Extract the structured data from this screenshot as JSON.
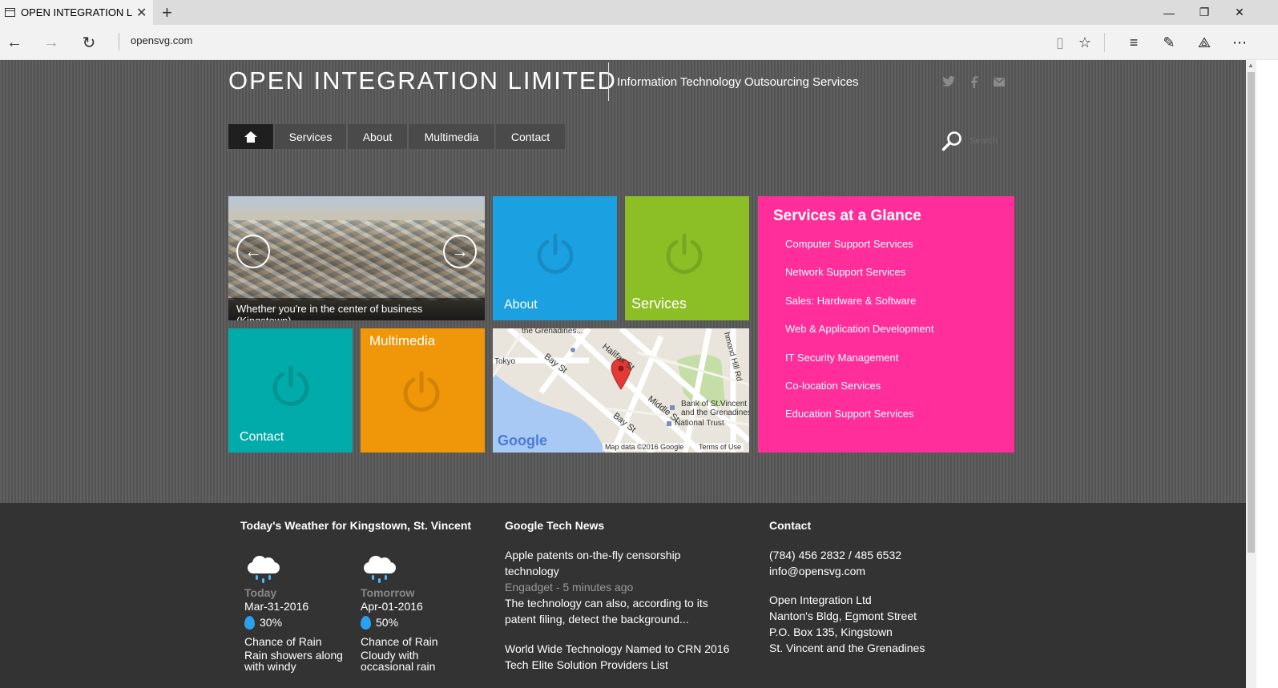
{
  "browser": {
    "tab_title": "OPEN INTEGRATION LIN",
    "address": "opensvg.com"
  },
  "site": {
    "title": "OPEN INTEGRATION LIMITED",
    "tagline": "Information Technology Outsourcing Services",
    "social_icons": [
      "twitter-icon",
      "facebook-icon",
      "mail-icon"
    ],
    "search_placeholder": "Search"
  },
  "menu": {
    "items": [
      {
        "label": "Services"
      },
      {
        "label": "About"
      },
      {
        "label": "Multimedia"
      },
      {
        "label": "Contact"
      }
    ]
  },
  "tiles": {
    "slide_caption": "Whether you're in the center of business (Kingstown)",
    "about": "About",
    "services": "Services",
    "contact": "Contact",
    "multimedia": "Multimedia",
    "colors": {
      "about": "#1ba1e2",
      "services": "#8cbf26",
      "contact": "#00aba9",
      "multimedia": "#f09609",
      "glance": "#ff2e9a"
    }
  },
  "map": {
    "labels": [
      "the Grenadines...",
      "Tokyo",
      "Bay St",
      "Halifax St",
      "Middle St",
      "Bay St",
      "hmond Hill Rd",
      "Bank of St.Vincent",
      "and the Grenadines",
      "National Trust"
    ],
    "attribution": "Map data ©2016 Google",
    "terms": "Terms of Use",
    "logo": "Google"
  },
  "glance": {
    "title": "Services at a Glance",
    "items": [
      "Computer Support Services",
      "Network Support Services",
      "Sales: Hardware & Software",
      "Web & Application Development",
      "IT Security Management",
      "Co-location Services",
      "Education Support Services"
    ]
  },
  "weather": {
    "heading": "Today's Weather for Kingstown, St. Vincent",
    "days": [
      {
        "day": "Today",
        "date": "Mar-31-2016",
        "chance": "30%",
        "label": "Chance of Rain",
        "desc": "Rain showers along with windy"
      },
      {
        "day": "Tomorrow",
        "date": "Apr-01-2016",
        "chance": "50%",
        "label": "Chance of Rain",
        "desc": "Cloudy with occasional rain"
      }
    ]
  },
  "news": {
    "heading": "Google Tech News",
    "items": [
      {
        "title": "Apple patents on-the-fly censorship technology",
        "source": "Engadget - 5 minutes ago",
        "snippet": "The technology can also, according to its patent filing, detect the background..."
      },
      {
        "title": "World Wide Technology Named to CRN 2016 Tech Elite Solution Providers List"
      }
    ]
  },
  "contact": {
    "heading": "Contact",
    "phone": "(784) 456 2832 / 485 6532",
    "email": "info@opensvg.com",
    "address": [
      "Open Integration Ltd",
      "Nanton's Bldg, Egmont Street",
      "P.O. Box 135, Kingstown",
      "St. Vincent and the Grenadines"
    ]
  }
}
